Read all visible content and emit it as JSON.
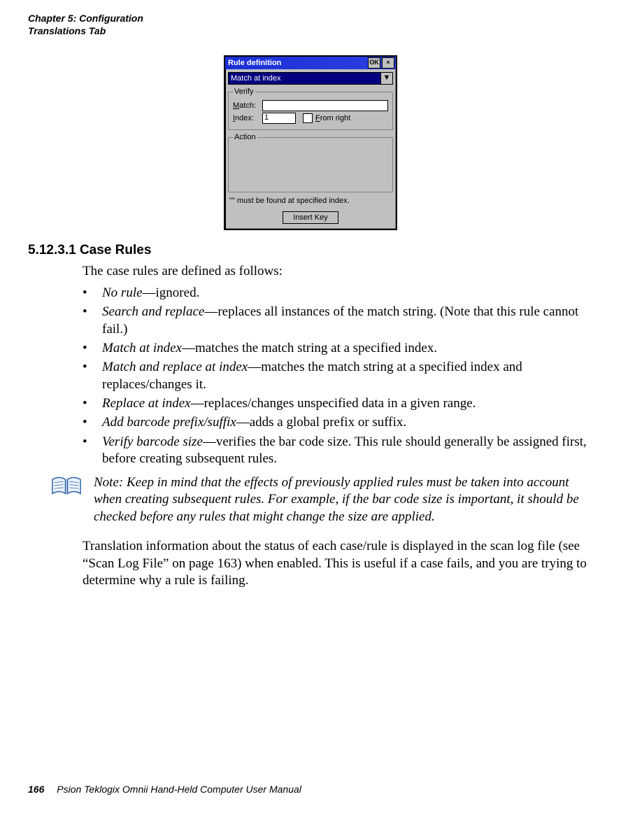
{
  "header": {
    "line1": "Chapter 5: Configuration",
    "line2": "Translations Tab"
  },
  "dialog": {
    "title": "Rule definition",
    "ok": "OK",
    "close": "×",
    "combo_value": "Match at index",
    "combo_arrow": "▼",
    "verify_legend": "Verify",
    "match_label_pre": "M",
    "match_label_post": "atch:",
    "match_value": "",
    "index_label_pre": "I",
    "index_label_post": "ndex:",
    "index_value": "1",
    "from_right_pre": "F",
    "from_right_post": "rom right",
    "action_legend": "Action",
    "hint": "\"\" must be found at specified index.",
    "insert_key": "Insert Key"
  },
  "section": {
    "number": "5.12.3.1",
    "title": "Case Rules",
    "intro": "The case rules are defined as follows:",
    "rules": [
      {
        "term": "No rule",
        "desc": "—ignored."
      },
      {
        "term": "Search and replace",
        "desc": "—replaces all instances of the match string. (Note that this rule cannot fail.)"
      },
      {
        "term": "Match at index",
        "desc": "—matches the match string at a specified index."
      },
      {
        "term": "Match and replace at index",
        "desc": "—matches the match string at a specified index and replaces/changes it."
      },
      {
        "term": "Replace at index",
        "desc": "—replaces/changes unspecified data in a given range."
      },
      {
        "term": "Add barcode prefix/suffix",
        "desc": "—adds a global prefix or suffix."
      },
      {
        "term": "Verify barcode size",
        "desc": "—verifies the bar code size. This rule should generally be assigned first, before creating subsequent rules."
      }
    ],
    "note_label": "Note:",
    "note_body": " Keep in mind that the effects of previously applied rules must be taken into account when creating subsequent rules. For example, if the bar code size is important, it should be checked before any rules that might change the size are applied.",
    "after": "Translation information about the status of each case/rule is displayed in the scan log file (see “Scan Log File” on page 163) when enabled. This is useful if a case fails, and you are trying to determine why a rule is failing."
  },
  "footer": {
    "page": "166",
    "text": "Psion Teklogix Omnii Hand-Held Computer User Manual"
  }
}
